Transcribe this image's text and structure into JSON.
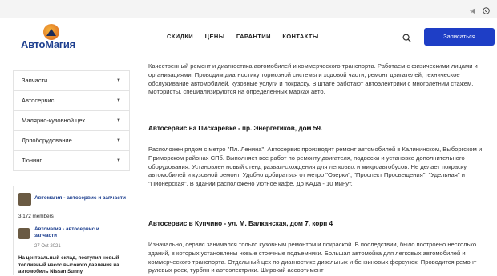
{
  "logo": {
    "text": "АвтоМагия"
  },
  "nav": {
    "items": [
      "СКИДКИ",
      "ЦЕНЫ",
      "ГАРАНТИИ",
      "КОНТАКТЫ"
    ]
  },
  "header": {
    "subscribe_label": "Записаться"
  },
  "sidebar": {
    "items": [
      {
        "label": "Запчасти"
      },
      {
        "label": "Автосервис"
      },
      {
        "label": "Малярно-кузовной цех"
      },
      {
        "label": "Допоборудование"
      },
      {
        "label": "Тюнинг"
      }
    ]
  },
  "widget": {
    "title": "Автомагия - автосервис и запчасти",
    "members": "3,172 members",
    "post": {
      "author": "Автомагия - автосервис и запчасти",
      "date": "27 Oct 2021",
      "text": "На центральный склад, поступил новый топливный насос высокого давления на автомобиль Nissan Sunny"
    }
  },
  "content": {
    "intro": "Качественный ремонт и диагностика автомобилей и коммерческого транспорта. Работаем с физическими лицами и организациями. Проводим диагностику тормозной системы и ходовой части, ремонт двигателей, техническое обслуживание автомобилей, кузовные услуги и покраску. В штате работают автоэлектрики с многолетним стажем. Мотористы, специализируются на определенных марках авто.",
    "section1_title": "Автосервис на Пискаревке - пр. Энергетиков, дом 59.",
    "section1_text": "Расположен рядом с метро \"Пл. Ленина\". Автосервис производит ремонт автомобилей в Калининском, Выборгском и Приморском районах СПб. Выполняет все работ по ремонту двигателя, подвески и установке дополнительного оборудования. Установлен новый стенд развал-схождения для легковых и микроавтобусов. Не делает покраску автомобилей и кузовной ремонт. Удобно добираться от метро \"Озерки\", \"Проспект Просвещения\", \"Удельная\" и \"Пионерская\". В здании расположено уютное кафе. До КАДа - 10 минут.",
    "section2_title": "Автосервис в Купчино - ул. М. Балканская, дом 7, корп 4",
    "section2_text": "Изначально, сервис занимался только кузовным ремонтом и покраской. В последствии, было построено несколько зданий, в которых установлены новые стоечные подъемники. Большая автомойка для легковых автомобилей и коммерческого транспорта. Отдельный цех по диагностике дизельных и бензиновых форсунок. Проводится ремонт рулевых реек, турбин и автоэлектрики. Широкий ассортимент"
  },
  "colors": {
    "accent": "#1e3ec6",
    "link": "#1d3f8f"
  }
}
